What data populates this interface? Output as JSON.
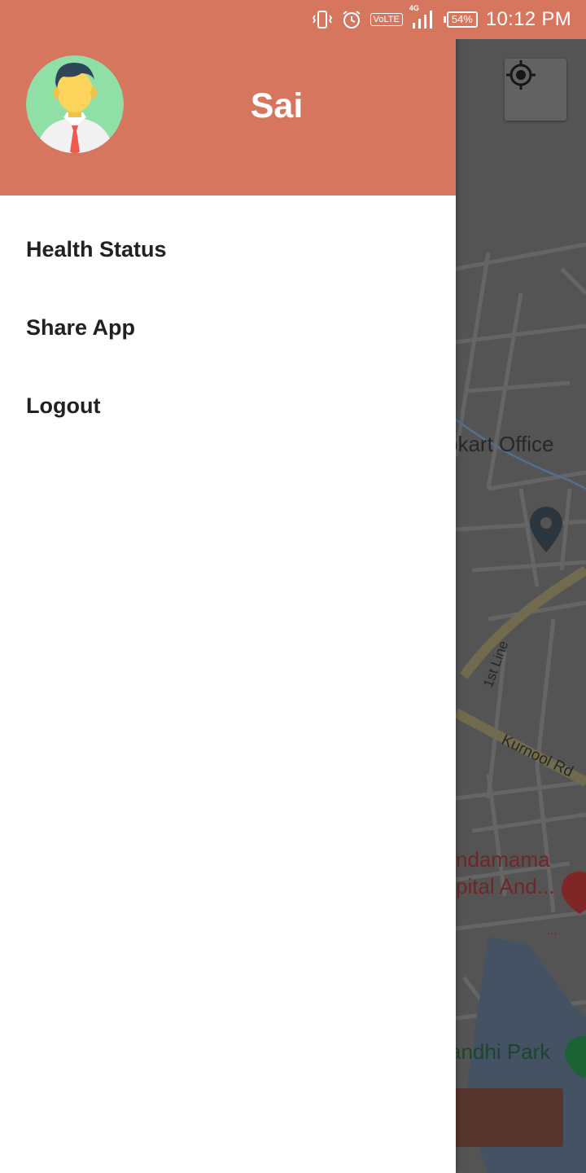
{
  "status_bar": {
    "time": "10:12 PM",
    "network": "4G",
    "volte": "VoLTE",
    "battery": "54%",
    "icons": [
      "vibrate-icon",
      "alarm-icon",
      "volte-icon",
      "signal-icon",
      "battery-icon"
    ]
  },
  "drawer": {
    "user_name": "Sai",
    "avatar_icon": "user-avatar",
    "items": [
      {
        "label": "Health Status"
      },
      {
        "label": "Share App"
      },
      {
        "label": "Logout"
      }
    ]
  },
  "map": {
    "labels": {
      "office": "pkart Office",
      "first_line": "1st Line",
      "kurnool_rd": "Kurnool Rd",
      "hospital_line1": "ndamama",
      "hospital_line2": "pital And...",
      "hospital_dots": "...",
      "park": "andhi Park"
    },
    "locate_icon": "my-location-icon"
  },
  "colors": {
    "accent": "#D6765F",
    "drawer_bg": "#FFFFFF",
    "menu_text": "#212121"
  }
}
